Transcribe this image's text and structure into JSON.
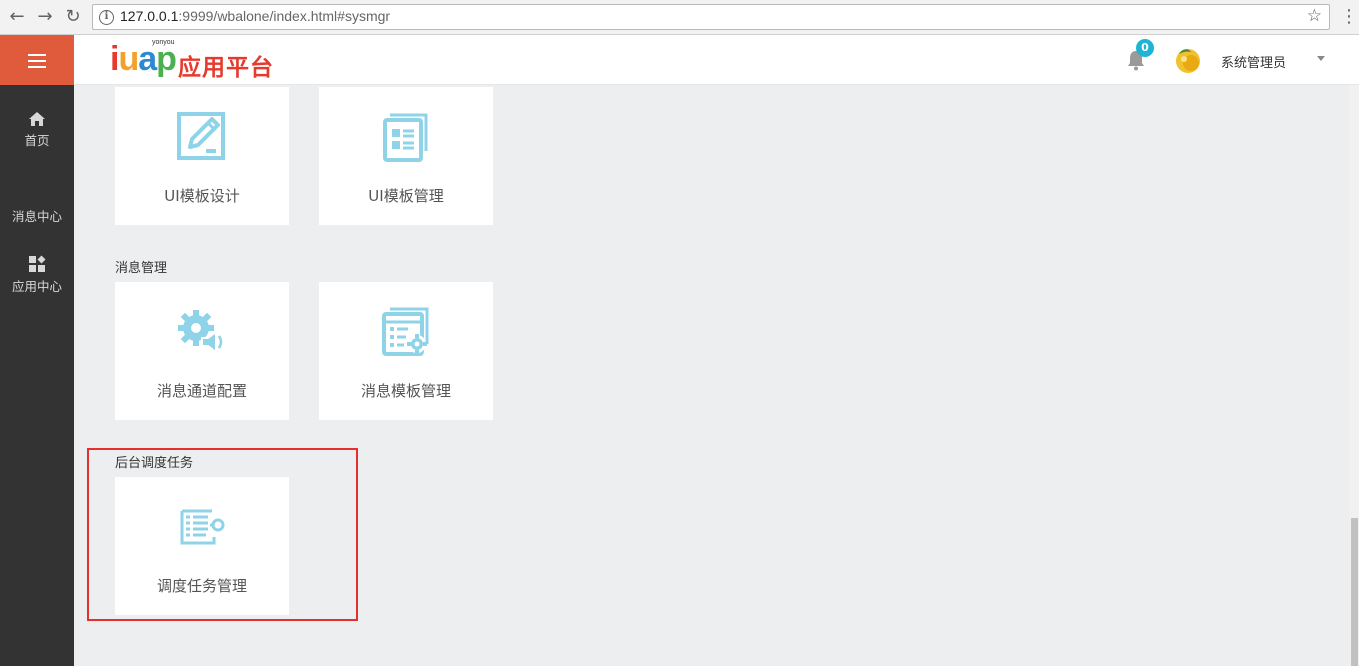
{
  "browser": {
    "url_host": "127.0.0.1",
    "url_rest": ":9999/wbalone/index.html#sysmgr"
  },
  "header": {
    "logo_small": "yonyou",
    "logo_iuap": [
      "i",
      "u",
      "a",
      "p"
    ],
    "logo_cn": "应用平台",
    "notification_count": "0",
    "user_name": "系统管理员"
  },
  "sidebar": {
    "items": [
      {
        "label": "首页",
        "icon": "home-icon"
      },
      {
        "label": "消息中心",
        "icon": "message-icon"
      },
      {
        "label": "应用中心",
        "icon": "apps-icon"
      }
    ]
  },
  "main": {
    "top_cards": [
      {
        "label": "UI模板设计",
        "icon": "template-design-icon"
      },
      {
        "label": "UI模板管理",
        "icon": "template-manage-icon"
      }
    ],
    "sections": [
      {
        "title": "消息管理",
        "cards": [
          {
            "label": "消息通道配置",
            "icon": "channel-config-icon"
          },
          {
            "label": "消息模板管理",
            "icon": "message-template-icon"
          }
        ]
      },
      {
        "title": "后台调度任务",
        "cards": [
          {
            "label": "调度任务管理",
            "icon": "schedule-task-icon"
          }
        ]
      }
    ]
  },
  "colors": {
    "accent_icon": "#8fd3e8",
    "sidebar_bg": "#333333",
    "hamburger_bg": "#e05a3c",
    "highlight_border": "#e3302f",
    "badge": "#1fb4d3"
  }
}
